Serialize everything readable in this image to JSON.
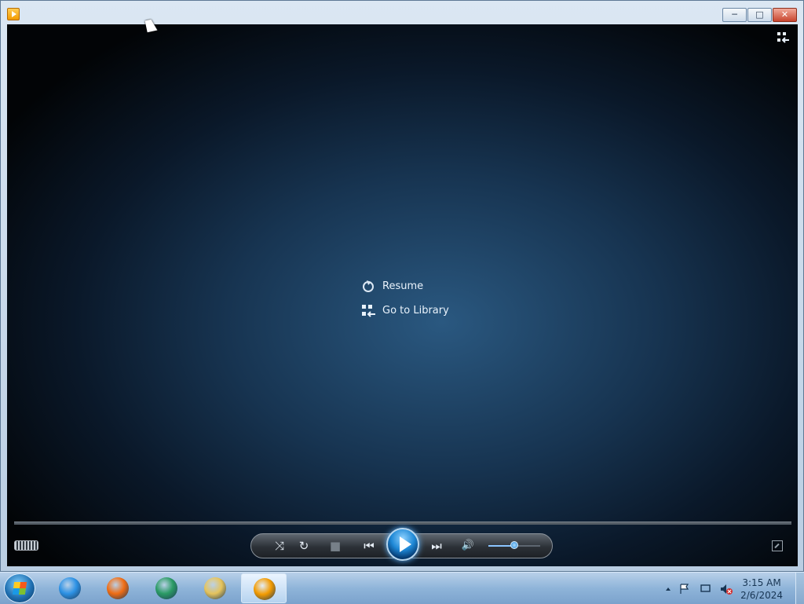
{
  "window": {
    "controls": [
      {
        "name": "minimize",
        "glyph": "─"
      },
      {
        "name": "maximize",
        "glyph": "□"
      },
      {
        "name": "close",
        "glyph": "✕"
      }
    ]
  },
  "overlay_menu": {
    "items": [
      {
        "label": "Resume",
        "icon": "refresh-icon"
      },
      {
        "label": "Go to Library",
        "icon": "library-icon"
      }
    ]
  },
  "playback": {
    "volume_level": 0.5,
    "buttons": [
      {
        "name": "shuffle",
        "glyph": "⤨"
      },
      {
        "name": "repeat",
        "glyph": "↻"
      },
      {
        "name": "stop",
        "glyph": "■"
      },
      {
        "name": "previous",
        "glyph": "⏮"
      },
      {
        "name": "play",
        "glyph": ""
      },
      {
        "name": "next",
        "glyph": "⏭"
      },
      {
        "name": "mute",
        "glyph": "🔊"
      }
    ]
  },
  "taskbar": {
    "clock": {
      "time": "3:15 AM",
      "date": "2/6/2024"
    },
    "apps": [
      {
        "name": "internet-explorer-icon",
        "color": "#2d92e5"
      },
      {
        "name": "firefox-icon",
        "color": "#f06d14"
      },
      {
        "name": "media-center-icon",
        "color": "#2b9b65"
      },
      {
        "name": "file-explorer-icon",
        "color": "#e6c45c"
      },
      {
        "name": "windows-media-player-icon",
        "color": "#f39b00"
      }
    ]
  }
}
